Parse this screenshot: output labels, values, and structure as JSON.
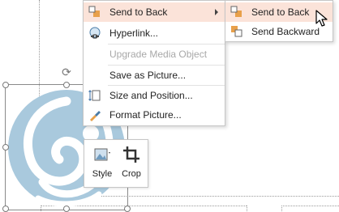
{
  "context_menu": {
    "items": [
      {
        "label": "Send to Back",
        "icon": "send-to-back-icon",
        "has_submenu": true,
        "highlighted": true,
        "disabled": false
      },
      {
        "label": "Hyperlink...",
        "icon": "hyperlink-icon",
        "has_submenu": false,
        "highlighted": false,
        "disabled": false
      },
      {
        "label": "Upgrade Media Object",
        "icon": "",
        "has_submenu": false,
        "highlighted": false,
        "disabled": true
      },
      {
        "label": "Save as Picture...",
        "icon": "",
        "has_submenu": false,
        "highlighted": false,
        "disabled": false
      },
      {
        "label": "Size and Position...",
        "icon": "size-position-icon",
        "has_submenu": false,
        "highlighted": false,
        "disabled": false
      },
      {
        "label": "Format Picture...",
        "icon": "format-picture-icon",
        "has_submenu": false,
        "highlighted": false,
        "disabled": false
      }
    ]
  },
  "submenu": {
    "items": [
      {
        "label": "Send to Back",
        "icon": "send-to-back-icon",
        "highlighted": true
      },
      {
        "label": "Send Backward",
        "icon": "send-backward-icon",
        "highlighted": false
      }
    ]
  },
  "mini_toolbar": {
    "style_label": "Style",
    "crop_label": "Crop"
  },
  "colors": {
    "highlight": "#fbe3d9",
    "accent": "#d96f3a",
    "picture_blue": "#a9c9dd"
  }
}
